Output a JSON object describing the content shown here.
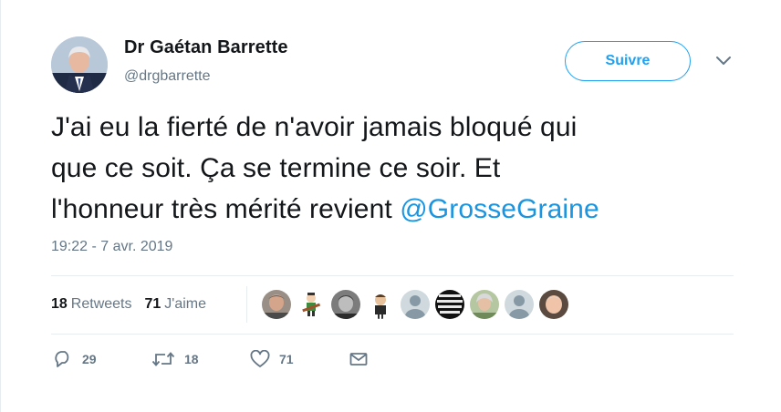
{
  "user": {
    "name": "Dr Gaétan Barrette",
    "handle": "@drgbarrette",
    "follow_label": "Suivre"
  },
  "tweet": {
    "text_line1": "J'ai eu la fierté de n'avoir jamais bloqué qui",
    "text_line2": "que ce soit. Ça se termine ce soir. Et",
    "text_line3": "l'honneur très mérité revient ",
    "mention": "@GrosseGraine",
    "timestamp": "19:22 - 7 avr. 2019"
  },
  "stats": {
    "retweets_count": "18",
    "retweets_label": "Retweets",
    "likes_count": "71",
    "likes_label": "J'aime"
  },
  "likers": [
    "photo-man",
    "cartoon-guitar",
    "photo-portrait",
    "cartoon-character",
    "default-avatar",
    "text-logo",
    "photo-woman",
    "default-avatar",
    "photo-man"
  ],
  "actions": {
    "reply_count": "29",
    "retweet_count": "18",
    "like_count": "71"
  },
  "colors": {
    "accent": "#1da1f2",
    "link": "#1b95e0",
    "muted": "#657786",
    "text": "#14171a",
    "divider": "#e6ecf0"
  }
}
